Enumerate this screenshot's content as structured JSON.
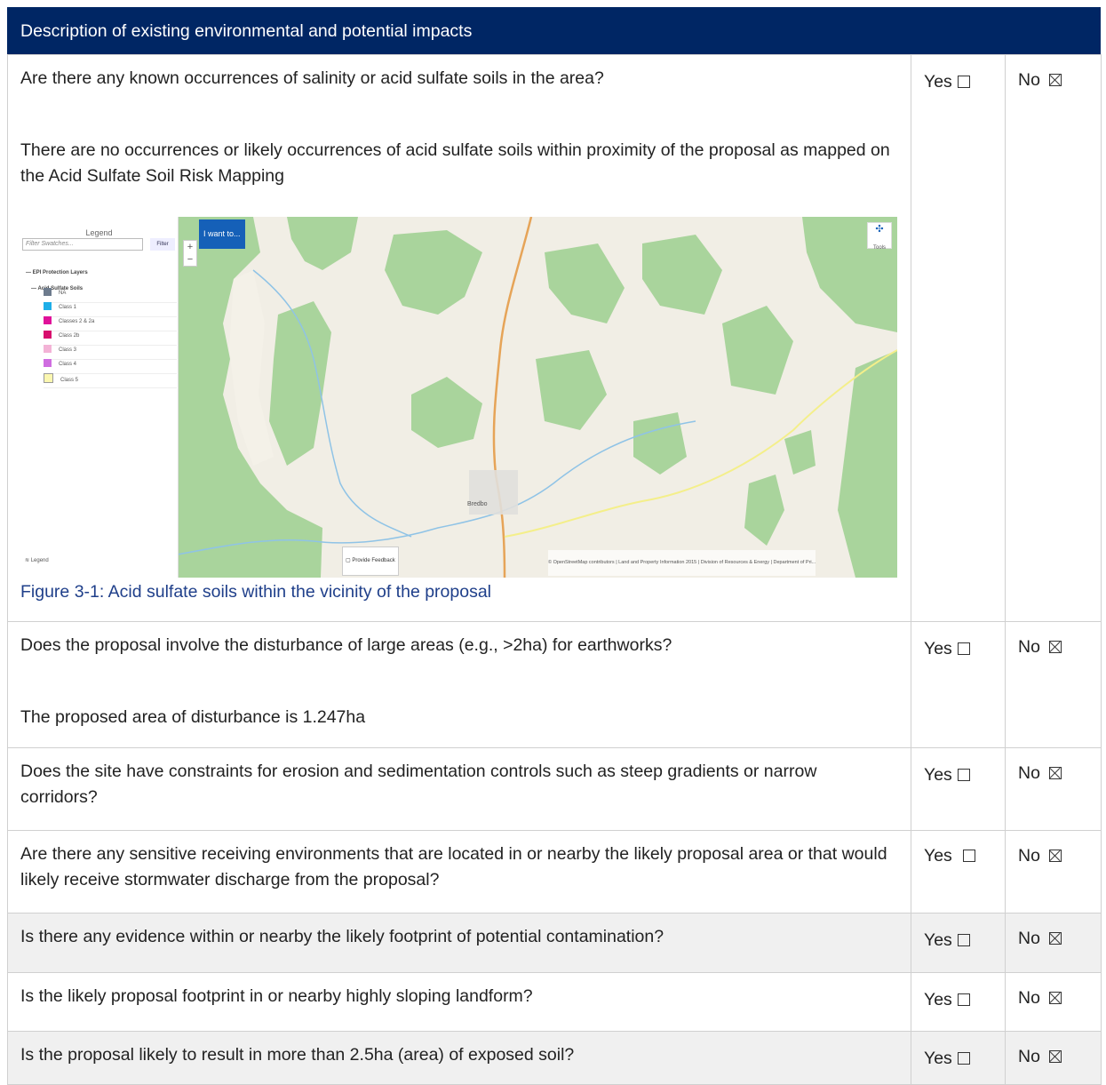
{
  "header": {
    "title": "Description of existing environmental and potential impacts"
  },
  "answers": {
    "yes_label": "Yes",
    "no_label": "No"
  },
  "rows": [
    {
      "question": "Are there any known occurrences of salinity or acid sulfate soils in the area?",
      "detail": "There are no occurrences or likely occurrences of acid sulfate soils within proximity of the proposal as mapped on the Acid Sulfate Soil Risk Mapping"
    },
    {
      "question": "Does the proposal involve the disturbance of large areas (e.g., >2ha) for earthworks?",
      "detail": "The proposed area of disturbance is 1.247ha"
    },
    {
      "question": "Does the site have constraints for erosion and sedimentation controls such as steep gradients or narrow corridors?"
    },
    {
      "question": "Are there any sensitive receiving environments that are located in or nearby the likely proposal area or that would likely receive stormwater discharge from the proposal?"
    },
    {
      "question": "Is there any evidence within or nearby the likely footprint of potential contamination?"
    },
    {
      "question": "Is the likely proposal footprint in or nearby highly sloping landform?"
    },
    {
      "question": "Is the proposal likely to result in more than 2.5ha (area) of exposed soil?"
    }
  ],
  "figure": {
    "caption": "Figure 3-1: Acid sulfate soils within the vicinity of the proposal",
    "map": {
      "legend_title": "Legend",
      "filter_placeholder": "Filter Swatches...",
      "filter_button": "Filter",
      "group1": "EPI Protection Layers",
      "group2": "Acid Sulfate Soils",
      "classes": [
        {
          "label": "NA",
          "color": "#6d7b8d"
        },
        {
          "label": "Class 1",
          "color": "#1eaee8"
        },
        {
          "label": "Classes 2 & 2a",
          "color": "#e0119a"
        },
        {
          "label": "Class 2b",
          "color": "#d80f6e"
        },
        {
          "label": "Class 3",
          "color": "#f3b3d6"
        },
        {
          "label": "Class 4",
          "color": "#cf6de0"
        },
        {
          "label": "Class 5",
          "color": "#fbf7b0"
        }
      ],
      "legend_tab": "Legend",
      "i_want_to": "I want to...",
      "tools": "Tools",
      "town": "Bredbo",
      "feedback": "Provide Feedback",
      "attribution": "© OpenStreetMap contributors | Land and Property Information 2015 | Division of Resources & Energy | Department of Pri..."
    }
  }
}
